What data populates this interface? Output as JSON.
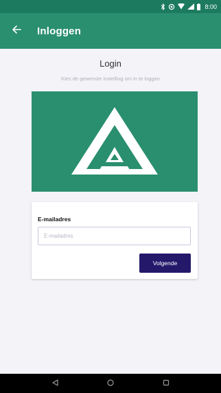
{
  "status_bar": {
    "time": "8:00",
    "icons": [
      "bluetooth-icon",
      "alarm-icon",
      "wifi-icon",
      "signal-icon",
      "battery-icon"
    ],
    "color": "#1c7a5e"
  },
  "app_bar": {
    "title": "Inloggen",
    "back_icon": "arrow-back-icon",
    "color": "#2a8f6e"
  },
  "main": {
    "title": "Login",
    "subtitle": "Kies de gewenste instelling om in te loggen",
    "logo": {
      "icon": "triangle-logo-icon",
      "background": "#2a8f6e"
    },
    "form": {
      "email_label": "E-mailadres",
      "email_placeholder": "E-mailadres",
      "email_value": "",
      "next_label": "Volgende",
      "button_color": "#24186b"
    }
  },
  "nav_bar": {
    "icons": [
      "back-triangle-icon",
      "home-circle-icon",
      "recents-square-icon"
    ]
  }
}
